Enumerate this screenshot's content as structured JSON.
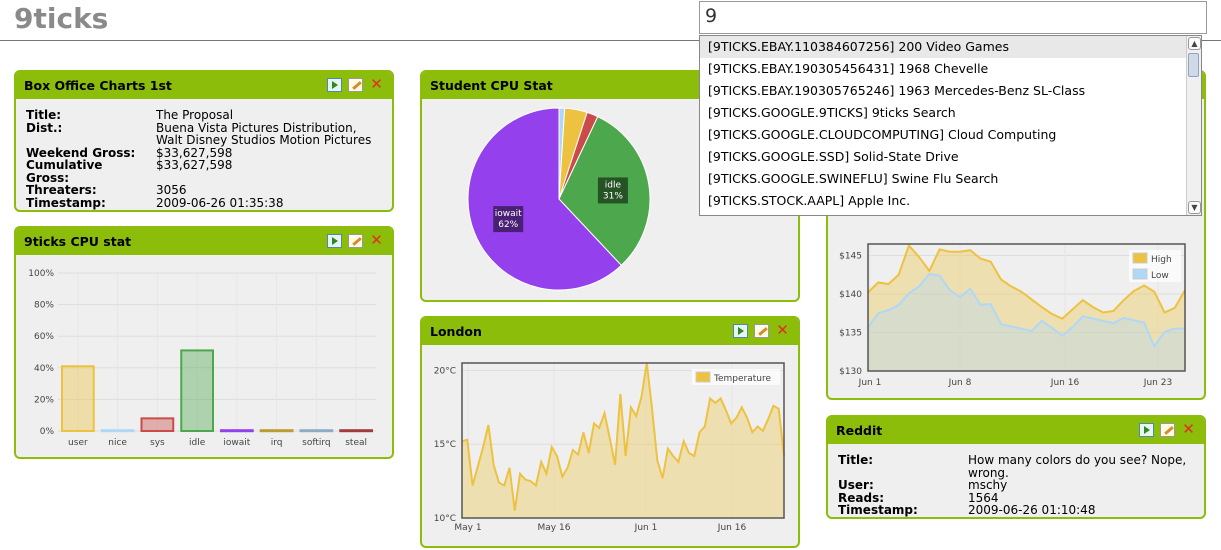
{
  "app": {
    "logo": "9ticks"
  },
  "search": {
    "value": "9"
  },
  "autocomplete": {
    "items": [
      "[9TICKS.EBAY.110384607256] 200 Video Games",
      "[9TICKS.EBAY.190305456431] 1968 Chevelle",
      "[9TICKS.EBAY.190305765246] 1963 Mercedes-Benz SL-Class",
      "[9TICKS.GOOGLE.9TICKS] 9ticks Search",
      "[9TICKS.GOOGLE.CLOUDCOMPUTING] Cloud Computing",
      "[9TICKS.GOOGLE.SSD] Solid-State Drive",
      "[9TICKS.GOOGLE.SWINEFLU] Swine Flu Search",
      "[9TICKS.STOCK.AAPL] Apple Inc."
    ],
    "selected_index": 0
  },
  "widgets": {
    "box_office": {
      "title": "Box Office Charts 1st",
      "rows": [
        {
          "key": "Title:",
          "value": "The Proposal"
        },
        {
          "key": "Dist.:",
          "value": "Buena Vista Pictures Distribution,\nWalt Disney Studios Motion Pictures"
        },
        {
          "key": "Weekend Gross:",
          "value": "$33,627,598"
        },
        {
          "key": "Cumulative Gross:",
          "value": "$33,627,598"
        },
        {
          "key": "Threaters:",
          "value": "3056"
        },
        {
          "key": "Timestamp:",
          "value": "2009-06-26 01:35:38"
        }
      ]
    },
    "cpu": {
      "title": "9ticks CPU stat"
    },
    "student_cpu": {
      "title": "Student CPU Stat"
    },
    "london": {
      "title": "London"
    },
    "stock": {
      "title": ""
    },
    "reddit": {
      "title": "Reddit",
      "rows": [
        {
          "key": "Title:",
          "value": "How many colors do you see? Nope, wrong."
        },
        {
          "key": "User:",
          "value": "mschy"
        },
        {
          "key": "Reads:",
          "value": "1564"
        },
        {
          "key": "Timestamp:",
          "value": "2009-06-26 01:10:48"
        }
      ]
    }
  },
  "chart_data": [
    {
      "id": "cpu",
      "type": "bar",
      "categories": [
        "user",
        "nice",
        "sys",
        "idle",
        "iowait",
        "irq",
        "softirq",
        "steal"
      ],
      "values": [
        41,
        0.5,
        8,
        51,
        0.5,
        0.5,
        0.5,
        0.5
      ],
      "colors": [
        "#edc240",
        "#afd8f8",
        "#cb4b4b",
        "#4da74d",
        "#9440ed",
        "#bd9b33",
        "#8cacc6",
        "#a23c3c"
      ],
      "yticks": [
        "0%",
        "20%",
        "40%",
        "60%",
        "80%",
        "100%"
      ],
      "ylim": [
        0,
        100
      ]
    },
    {
      "id": "student_cpu",
      "type": "pie",
      "slices": [
        {
          "label": "",
          "value": 1,
          "color": "#afd8f8"
        },
        {
          "label": "",
          "value": 4,
          "color": "#edc240"
        },
        {
          "label": "",
          "value": 2,
          "color": "#cb4b4b"
        },
        {
          "label": "idle\n31%",
          "value": 31,
          "color": "#4da74d"
        },
        {
          "label": "iowait\n62%",
          "value": 62,
          "color": "#9440ed"
        }
      ]
    },
    {
      "id": "london",
      "type": "area",
      "series": [
        {
          "name": "Temperature",
          "color": "#edc240"
        }
      ],
      "x_ticks": [
        "May 1",
        "May 16",
        "Jun 1",
        "Jun 16"
      ],
      "y_ticks": [
        "10°C",
        "15°C",
        "20°C"
      ],
      "ylim": [
        10,
        20.5
      ],
      "values": [
        15.2,
        15.3,
        12.2,
        13.5,
        14.8,
        16.3,
        13.6,
        12.4,
        12.2,
        13.4,
        10.5,
        13.0,
        12.6,
        12.5,
        12.2,
        13.8,
        13.0,
        14.8,
        14.2,
        12.8,
        13.4,
        14.6,
        14.3,
        15.8,
        14.4,
        16.4,
        16.1,
        17.1,
        15.4,
        13.6,
        18.4,
        14.2,
        17.5,
        16.9,
        18.2,
        20.5,
        17.4,
        13.9,
        12.7,
        14.7,
        14.2,
        13.8,
        15.2,
        14.4,
        14.2,
        15.8,
        16.2,
        18.1,
        17.8,
        18.1,
        17.3,
        16.4,
        16.8,
        17.5,
        16.8,
        15.8,
        16.2,
        15.9,
        16.7,
        17.6,
        17.4,
        14.2
      ]
    },
    {
      "id": "stock",
      "type": "area",
      "series": [
        {
          "name": "High",
          "color": "#edc240",
          "values": [
            140.2,
            141.5,
            141.3,
            142.5,
            146.3,
            144.8,
            143.0,
            145.8,
            145.5,
            145.5,
            145.7,
            144.6,
            144.2,
            141.9,
            141.0,
            140.3,
            139.3,
            138.3,
            137.4,
            136.8,
            138.0,
            139.2,
            138.3,
            137.6,
            137.8,
            139.2,
            140.4,
            141.1,
            140.3,
            137.6,
            138.2,
            140.5
          ]
        },
        {
          "name": "Low",
          "color": "#afd8f8",
          "values": [
            135.7,
            137.5,
            137.9,
            138.6,
            140.1,
            141.0,
            142.6,
            142.4,
            140.5,
            139.6,
            140.7,
            138.6,
            138.7,
            136.1,
            135.8,
            135.5,
            135.2,
            136.5,
            135.6,
            134.6,
            135.7,
            137.1,
            136.8,
            136.5,
            136.2,
            136.9,
            136.6,
            136.3,
            133.2,
            135.1,
            135.5,
            135.5
          ]
        }
      ],
      "x_ticks": [
        "Jun 1",
        "Jun 8",
        "Jun 16",
        "Jun 23"
      ],
      "y_ticks": [
        "$130",
        "$135",
        "$140",
        "$145"
      ],
      "ylim": [
        130,
        146.5
      ]
    }
  ]
}
